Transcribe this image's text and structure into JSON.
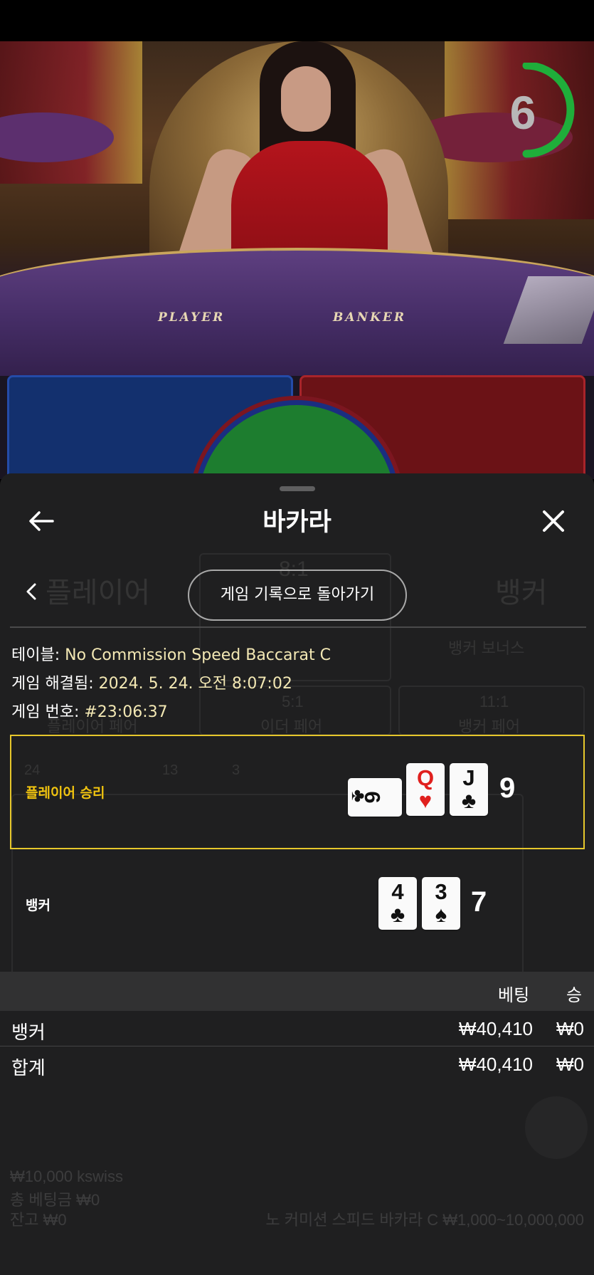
{
  "header": {
    "title": "바카라",
    "back_label": "게임 기록으로 돌아가기"
  },
  "game_info": {
    "table_label": "테이블:",
    "table_value": "No Commission Speed Baccarat C",
    "resolved_label": "게임 해결됨:",
    "resolved_value": "2024. 5. 24. 오전 8:07:02",
    "number_label": "게임 번호:",
    "number_value": "#23:06:37"
  },
  "result": {
    "player": {
      "label": "플레이어 승리",
      "cards": [
        {
          "rank": "6",
          "suit": "♣",
          "color": "black",
          "sideways": true
        },
        {
          "rank": "Q",
          "suit": "♥",
          "color": "red",
          "sideways": false
        },
        {
          "rank": "J",
          "suit": "♣",
          "color": "black",
          "sideways": false
        }
      ],
      "score": "9"
    },
    "banker": {
      "label": "뱅커",
      "cards": [
        {
          "rank": "4",
          "suit": "♣",
          "color": "black",
          "sideways": false
        },
        {
          "rank": "3",
          "suit": "♠",
          "color": "black",
          "sideways": false
        }
      ],
      "score": "7"
    }
  },
  "bets_table": {
    "headers": {
      "bet": "베팅",
      "win": "승"
    },
    "rows": [
      {
        "name": "뱅커",
        "bet": "₩40,410",
        "win": "₩0"
      },
      {
        "name": "합계",
        "bet": "₩40,410",
        "win": "₩0"
      }
    ]
  },
  "video": {
    "countdown": "6",
    "table_player": "PLAYER",
    "table_banker": "BANKER"
  },
  "background_ui": {
    "player_label": "플레이어",
    "banker_label": "뱅커",
    "tie_odds": "8:1",
    "banker_bonus": "뱅커 보너스",
    "either_pair_odds": "5:1",
    "either_pair": "이더 페어",
    "banker_pair_odds": "11:1",
    "banker_pair": "뱅커 페어",
    "player_pair": "플레이어 페어",
    "road_player_count": "24",
    "road_banker_count": "13",
    "road_tie_count": "3",
    "balance_line": "₩10,000 kswiss",
    "total_bet": "총 베팅금 ₩0",
    "balance": "잔고 ₩0",
    "table_limits": "노 커미션 스피드 바카라 C ₩1,000~10,000,000"
  },
  "colors": {
    "accent_gold": "#e6c72b",
    "win_yellow": "#f1c40f",
    "countdown_green": "#1fae3a",
    "value_text": "#f3e8b4"
  }
}
